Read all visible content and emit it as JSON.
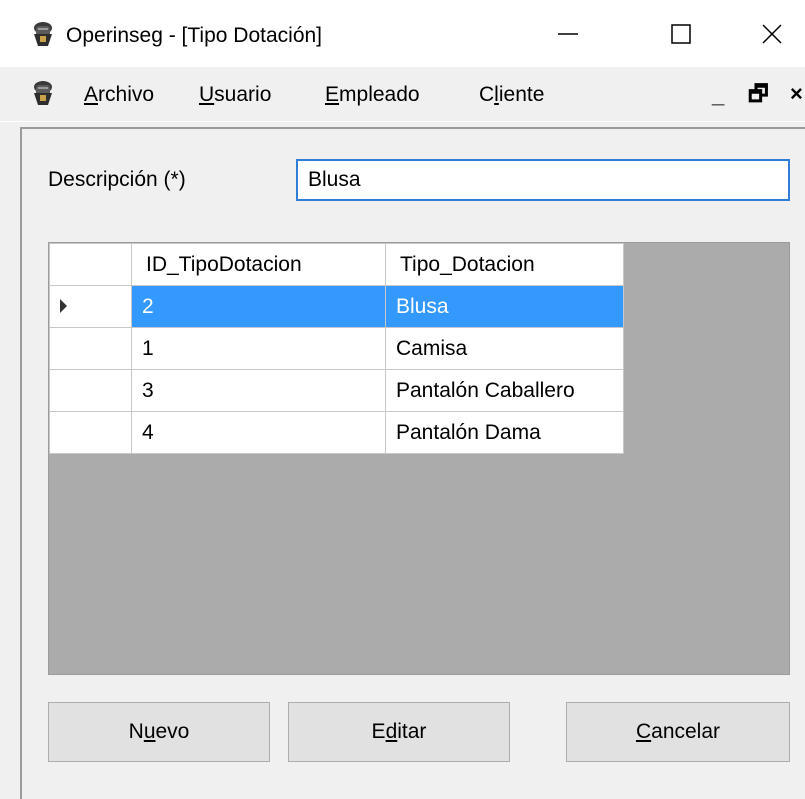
{
  "window": {
    "title": "Operinseg - [Tipo Dotación]",
    "caption_buttons": [
      "minimize-icon",
      "maximize-icon",
      "close-icon"
    ]
  },
  "menu": {
    "items": [
      {
        "label_pre": "",
        "mnemonic": "A",
        "label_post": "rchivo"
      },
      {
        "label_pre": "",
        "mnemonic": "U",
        "label_post": "suario"
      },
      {
        "label_pre": "",
        "mnemonic": "E",
        "label_post": "mpleado"
      },
      {
        "label_pre": "C",
        "mnemonic": "l",
        "label_post": "iente"
      }
    ],
    "mdi_controls": [
      "_",
      "🗗",
      "×"
    ]
  },
  "form": {
    "description_label": "Descripción (*)",
    "description_value": "Blusa"
  },
  "grid": {
    "columns": [
      "ID_TipoDotacion",
      "Tipo_Dotacion"
    ],
    "rows": [
      {
        "id": "2",
        "tipo": "Blusa",
        "selected": true
      },
      {
        "id": "1",
        "tipo": "Camisa",
        "selected": false
      },
      {
        "id": "3",
        "tipo": "Pantalón Caballero",
        "selected": false
      },
      {
        "id": "4",
        "tipo": "Pantalón Dama",
        "selected": false
      }
    ]
  },
  "buttons": {
    "nuevo": {
      "pre": "N",
      "mnemonic": "u",
      "post": "evo"
    },
    "editar": {
      "pre": "E",
      "mnemonic": "d",
      "post": "itar"
    },
    "cancelar": {
      "pre": "",
      "mnemonic": "C",
      "post": "ancelar"
    }
  },
  "colors": {
    "selection": "#3399ff",
    "input_border": "#2f7fd6",
    "grid_background": "#ababab"
  }
}
